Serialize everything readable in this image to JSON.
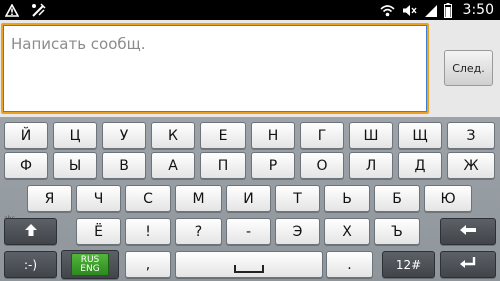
{
  "status_bar": {
    "time": "3:50",
    "icons": [
      "warning-icon",
      "usb-debug-icon",
      "wifi-icon",
      "mute-icon",
      "signal-icon",
      "battery-icon"
    ]
  },
  "compose": {
    "placeholder": "Написать сообщ.",
    "value": "",
    "next_label": "След."
  },
  "keyboard": {
    "row1": [
      "Й",
      "Ц",
      "У",
      "К",
      "Е",
      "Н",
      "Г",
      "Ш",
      "Щ",
      "З"
    ],
    "row2": [
      "Ф",
      "Ы",
      "В",
      "А",
      "П",
      "Р",
      "О",
      "Л",
      "Д",
      "Ж"
    ],
    "row3": [
      "Я",
      "Ч",
      "С",
      "М",
      "И",
      "Т",
      "Ь",
      "Б",
      "Ю"
    ],
    "row4": [
      "Ё",
      "!",
      "?",
      "-",
      "Э",
      "Х",
      "Ъ"
    ],
    "small_label": "abc",
    "smiley_label": ":-)",
    "lang_line1": "RUS",
    "lang_line2": "ENG",
    "comma": ",",
    "period": ".",
    "symbols_label": "12#",
    "shift_icon": "shift-arrow-icon",
    "backspace_icon": "backspace-icon",
    "enter_icon": "enter-icon",
    "space_icon": "space-icon"
  },
  "colors": {
    "accent_border": "#f0a020",
    "lang_badge": "#3a9a2a"
  }
}
